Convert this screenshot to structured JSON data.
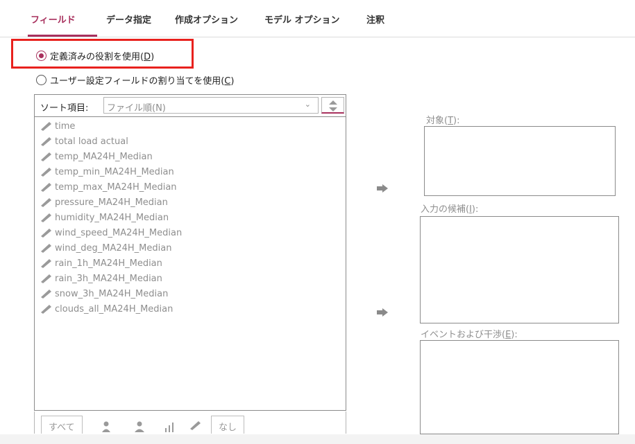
{
  "tabs": [
    {
      "label": "フィールド",
      "active": true
    },
    {
      "label": "データ指定",
      "active": false
    },
    {
      "label": "作成オプション",
      "active": false
    },
    {
      "label": "モデル オプション",
      "active": false
    },
    {
      "label": "注釈",
      "active": false
    }
  ],
  "roles": {
    "predefined_label": "定義済みの役割を使用(",
    "predefined_key": "D",
    "custom_label": "ユーザー設定フィールドの割り当てを使用(",
    "custom_key": "C",
    "close_paren": ")",
    "selected": "predefined"
  },
  "sort": {
    "label": "ソート項目:",
    "selected": "ファイル順(N)"
  },
  "fields": [
    "time",
    "total load actual",
    "temp_MA24H_Median",
    "temp_min_MA24H_Median",
    "temp_max_MA24H_Median",
    "pressure_MA24H_Median",
    "humidity_MA24H_Median",
    "wind_speed_MA24H_Median",
    "wind_deg_MA24H_Median",
    "rain_1h_MA24H_Median",
    "rain_3h_MA24H_Median",
    "snow_3h_MA24H_Median",
    "clouds_all_MA24H_Median"
  ],
  "bottom_buttons": {
    "all": "すべて",
    "none": "なし"
  },
  "targets": {
    "target_label": "対象(",
    "target_key": "T",
    "inputs_label": "入力の候補(",
    "inputs_key": "I",
    "events_label": "イベントおよび干渉(",
    "events_key": "E",
    "suffix": "):"
  },
  "colors": {
    "accent": "#a8305d",
    "highlight": "#e8211d",
    "muted": "#8e8e8e"
  }
}
